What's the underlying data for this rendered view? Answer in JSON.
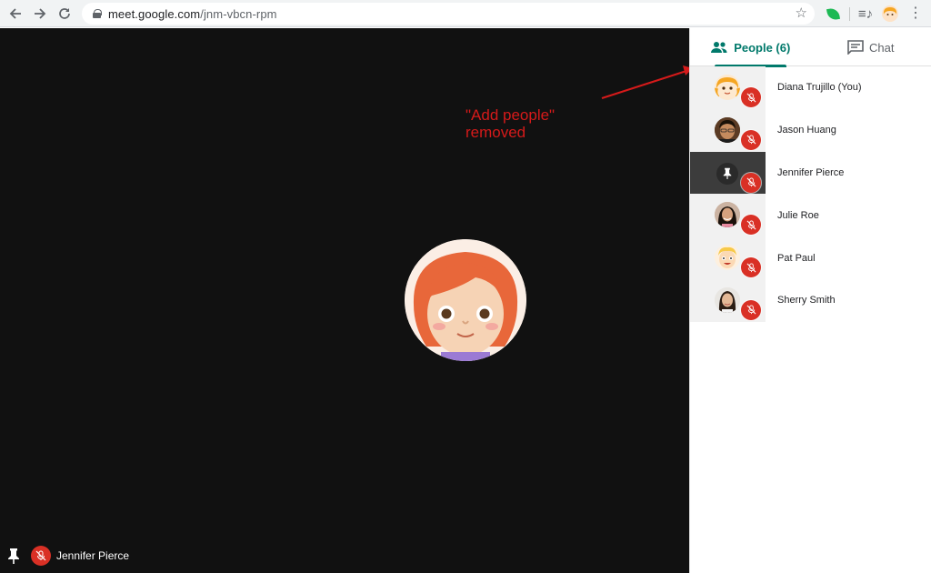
{
  "browser": {
    "url_host": "meet.google.com",
    "url_path": "/jnm-vbcn-rpm",
    "back_icon": "arrow-left-icon",
    "forward_icon": "arrow-right-icon",
    "reload_icon": "reload-icon"
  },
  "stage": {
    "participant_name": "Jennifer Pierce"
  },
  "annotation": {
    "text": "\"Add people\"\nremoved",
    "color": "#d51a1a"
  },
  "panel": {
    "tabs": [
      {
        "label": "People (6)",
        "icon": "people-icon",
        "active": true
      },
      {
        "label": "Chat",
        "icon": "chat-icon",
        "active": false
      }
    ],
    "people": [
      {
        "name": "Diana Trujillo (You)",
        "avatar": "cartoon-girl-avatar",
        "muted": true
      },
      {
        "name": "Jason Huang",
        "avatar": "photo-avatar",
        "muted": true
      },
      {
        "name": "Jennifer Pierce",
        "avatar": "pin-icon",
        "muted": true,
        "pinned": true
      },
      {
        "name": "Julie Roe",
        "avatar": "photo-avatar",
        "muted": true
      },
      {
        "name": "Pat Paul",
        "avatar": "cartoon-boy-avatar",
        "muted": true
      },
      {
        "name": "Sherry Smith",
        "avatar": "photo-avatar",
        "muted": true
      }
    ]
  },
  "colors": {
    "accent": "#00796b",
    "mute_red": "#d93025",
    "stage_bg": "#111111"
  }
}
